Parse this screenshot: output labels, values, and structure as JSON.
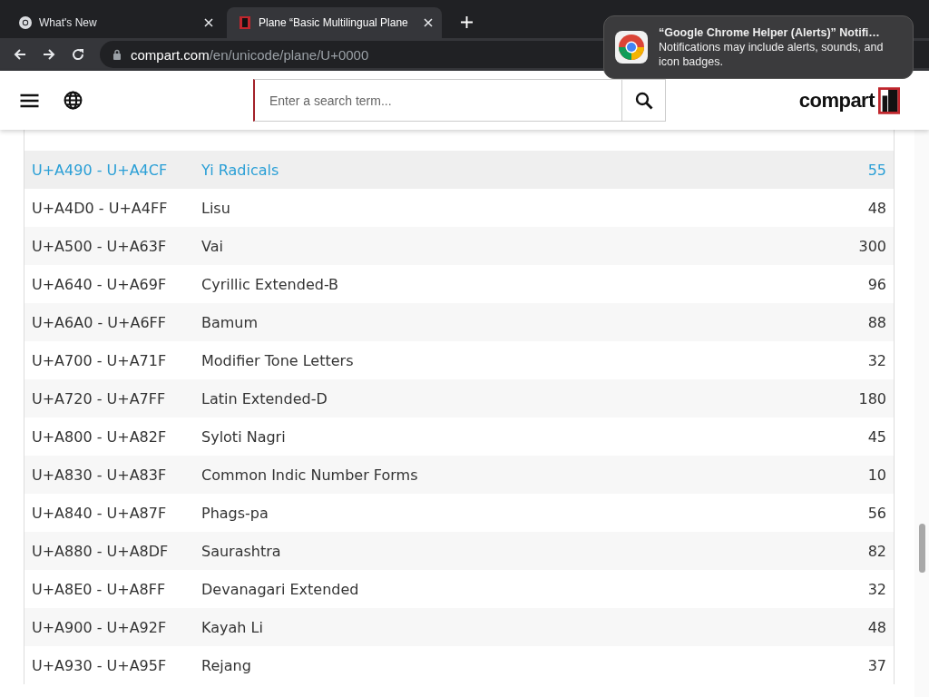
{
  "browser": {
    "tabs": [
      {
        "title": "What's New",
        "kind": "app",
        "selected": false
      },
      {
        "title": "Plane “Basic Multilingual Plane",
        "kind": "site",
        "selected": true
      }
    ],
    "address": {
      "host": "compart.com",
      "path": "/en/unicode/plane/U+0000"
    }
  },
  "site_header": {
    "search": {
      "placeholder": "Enter a search term..."
    },
    "logo": "compart"
  },
  "table": {
    "rows": [
      {
        "range": "U+A490 - U+A4CF",
        "name": "Yi Radicals",
        "count": "55",
        "selected": true
      },
      {
        "range": "U+A4D0 - U+A4FF",
        "name": "Lisu",
        "count": "48",
        "selected": false
      },
      {
        "range": "U+A500 - U+A63F",
        "name": "Vai",
        "count": "300",
        "selected": false
      },
      {
        "range": "U+A640 - U+A69F",
        "name": "Cyrillic Extended-B",
        "count": "96",
        "selected": false
      },
      {
        "range": "U+A6A0 - U+A6FF",
        "name": "Bamum",
        "count": "88",
        "selected": false
      },
      {
        "range": "U+A700 - U+A71F",
        "name": "Modifier Tone Letters",
        "count": "32",
        "selected": false
      },
      {
        "range": "U+A720 - U+A7FF",
        "name": "Latin Extended-D",
        "count": "180",
        "selected": false
      },
      {
        "range": "U+A800 - U+A82F",
        "name": "Syloti Nagri",
        "count": "45",
        "selected": false
      },
      {
        "range": "U+A830 - U+A83F",
        "name": "Common Indic Number Forms",
        "count": "10",
        "selected": false
      },
      {
        "range": "U+A840 - U+A87F",
        "name": "Phags-pa",
        "count": "56",
        "selected": false
      },
      {
        "range": "U+A880 - U+A8DF",
        "name": "Saurashtra",
        "count": "82",
        "selected": false
      },
      {
        "range": "U+A8E0 - U+A8FF",
        "name": "Devanagari Extended",
        "count": "32",
        "selected": false
      },
      {
        "range": "U+A900 - U+A92F",
        "name": "Kayah Li",
        "count": "48",
        "selected": false
      },
      {
        "range": "U+A930 - U+A95F",
        "name": "Rejang",
        "count": "37",
        "selected": false
      }
    ]
  },
  "notification": {
    "title": "“Google Chrome Helper (Alerts)” Notifi…",
    "body": "Notifications may include alerts, sounds, and icon badges."
  }
}
